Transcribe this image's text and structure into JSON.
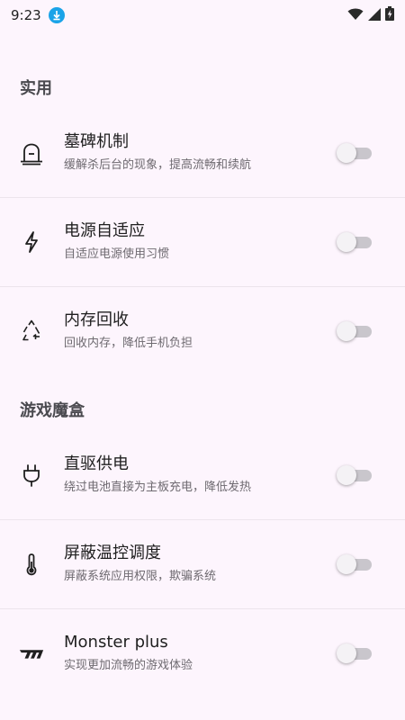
{
  "status_bar": {
    "time": "9:23",
    "icons": [
      "download-notification-icon",
      "wifi-icon",
      "signal-icon",
      "battery-charging-icon"
    ]
  },
  "sections": [
    {
      "header": "实用",
      "items": [
        {
          "icon": "tombstone-icon",
          "title": "墓碑机制",
          "subtitle": "缓解杀后台的现象，提高流畅和续航",
          "enabled": false
        },
        {
          "icon": "lightning-icon",
          "title": "电源自适应",
          "subtitle": "自适应电源使用习惯",
          "enabled": false
        },
        {
          "icon": "recycle-icon",
          "title": "内存回收",
          "subtitle": "回收内存，降低手机负担",
          "enabled": false
        }
      ]
    },
    {
      "header": "游戏魔盒",
      "items": [
        {
          "icon": "power-plug-icon",
          "title": "直驱供电",
          "subtitle": "绕过电池直接为主板充电，降低发热",
          "enabled": false
        },
        {
          "icon": "thermometer-icon",
          "title": "屏蔽温控调度",
          "subtitle": "屏蔽系统应用权限，欺骗系统",
          "enabled": false
        },
        {
          "icon": "monster-logo-icon",
          "title": "Monster plus",
          "subtitle": "实现更加流畅的游戏体验",
          "enabled": false
        }
      ]
    }
  ],
  "colors": {
    "background": "#fdf5fd",
    "switch_track_off": "#c9c6cc",
    "switch_thumb_off": "#f4f2f5",
    "download_badge": "#1aa3e8"
  }
}
